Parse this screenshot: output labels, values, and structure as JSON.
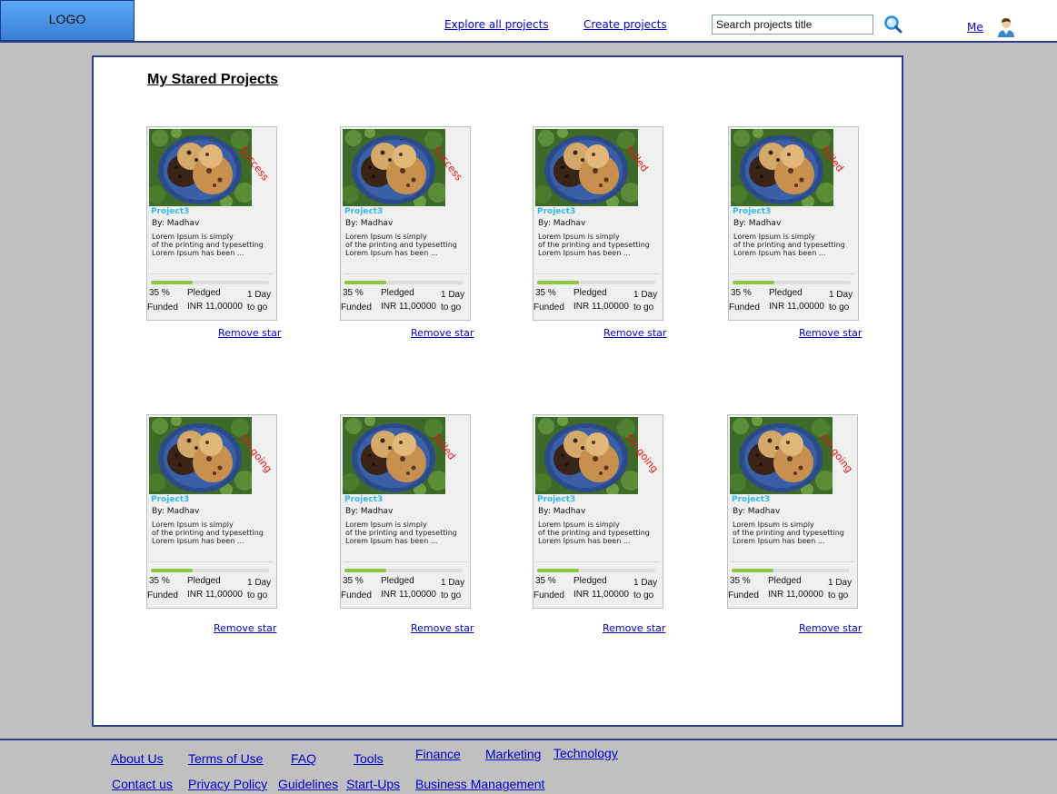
{
  "header": {
    "logo": "LOGO",
    "nav": [
      {
        "label": "Explore all projects"
      },
      {
        "label": "Create projects"
      }
    ],
    "search": {
      "value": "Search projects title"
    },
    "user_label": "Me"
  },
  "main": {
    "title": "My Stared Projects",
    "remove_label": "Remove star",
    "projects": [
      {
        "status": "Success",
        "name": "Project3",
        "by": "By: Madhav",
        "desc": "Lorem Ipsum is simply\nof the printing and typesetting\nLorem Ipsum has been ...",
        "funded_pct": "35 %",
        "funded_label": "Funded",
        "pledged_label": "Pledged",
        "pledged_value": "INR 11,00000",
        "days": "1 Day",
        "to_go": "to go",
        "progress": 0.35
      },
      {
        "status": "Success",
        "name": "Project3",
        "by": "By: Madhav",
        "desc": "Lorem Ipsum is simply\nof the printing and typesetting\nLorem Ipsum has been ...",
        "funded_pct": "35 %",
        "funded_label": "Funded",
        "pledged_label": "Pledged",
        "pledged_value": "INR 11,00000",
        "days": "1 Day",
        "to_go": "to go",
        "progress": 0.35
      },
      {
        "status": "Failed",
        "name": "Project3",
        "by": "By: Madhav",
        "desc": "Lorem Ipsum is simply\nof the printing and typesetting\nLorem Ipsum has been ...",
        "funded_pct": "35 %",
        "funded_label": "Funded",
        "pledged_label": "Pledged",
        "pledged_value": "INR 11,00000",
        "days": "1 Day",
        "to_go": "to go",
        "progress": 0.35
      },
      {
        "status": "Failed",
        "name": "Project3",
        "by": "By: Madhav",
        "desc": "Lorem Ipsum is simply\nof the printing and typesetting\nLorem Ipsum has been ...",
        "funded_pct": "35 %",
        "funded_label": "Funded",
        "pledged_label": "Pledged",
        "pledged_value": "INR 11,00000",
        "days": "1 Day",
        "to_go": "to go",
        "progress": 0.35
      },
      {
        "status": "On going",
        "name": "Project3",
        "by": "By: Madhav",
        "desc": "Lorem Ipsum is simply\nof the printing and typesetting\nLorem Ipsum has been ...",
        "funded_pct": "35 %",
        "funded_label": "Funded",
        "pledged_label": "Pledged",
        "pledged_value": "INR 11,00000",
        "days": "1 Day",
        "to_go": "to go",
        "progress": 0.35
      },
      {
        "status": "Failed",
        "name": "Project3",
        "by": "By: Madhav",
        "desc": "Lorem Ipsum is simply\nof the printing and typesetting\nLorem Ipsum has been ...",
        "funded_pct": "35 %",
        "funded_label": "Funded",
        "pledged_label": "Pledged",
        "pledged_value": "INR 11,00000",
        "days": "1 Day",
        "to_go": "to go",
        "progress": 0.35
      },
      {
        "status": "On going",
        "name": "Project3",
        "by": "By: Madhav",
        "desc": "Lorem Ipsum is simply\nof the printing and typesetting\nLorem Ipsum has been ...",
        "funded_pct": "35 %",
        "funded_label": "Funded",
        "pledged_label": "Pledged",
        "pledged_value": "INR 11,00000",
        "days": "1 Day",
        "to_go": "to go",
        "progress": 0.35
      },
      {
        "status": "On going",
        "name": "Project3",
        "by": "By: Madhav",
        "desc": "Lorem Ipsum is simply\nof the printing and typesetting\nLorem Ipsum has been ...",
        "funded_pct": "35 %",
        "funded_label": "Funded",
        "pledged_label": "Pledged",
        "pledged_value": "INR 11,00000",
        "days": "1 Day",
        "to_go": "to go",
        "progress": 0.35
      }
    ]
  },
  "footer": {
    "links": [
      {
        "label": "About Us"
      },
      {
        "label": "Terms of Use"
      },
      {
        "label": "FAQ"
      },
      {
        "label": "Tools"
      },
      {
        "label": "Finance"
      },
      {
        "label": "Marketing"
      },
      {
        "label": "Technology"
      },
      {
        "label": "Contact us"
      },
      {
        "label": "Privacy Policy"
      },
      {
        "label": "Guidelines"
      },
      {
        "label": "Start-Ups"
      },
      {
        "label": "Business Management"
      }
    ]
  },
  "colors": {
    "border_blue": "#2b3f8c",
    "status_red": "#ee1111",
    "project_name": "#33b8e8",
    "progress_green": "#8dc63f",
    "page_bg": "#c0c0c0"
  },
  "icons": {
    "search": "search-icon",
    "user": "user-avatar-icon"
  }
}
